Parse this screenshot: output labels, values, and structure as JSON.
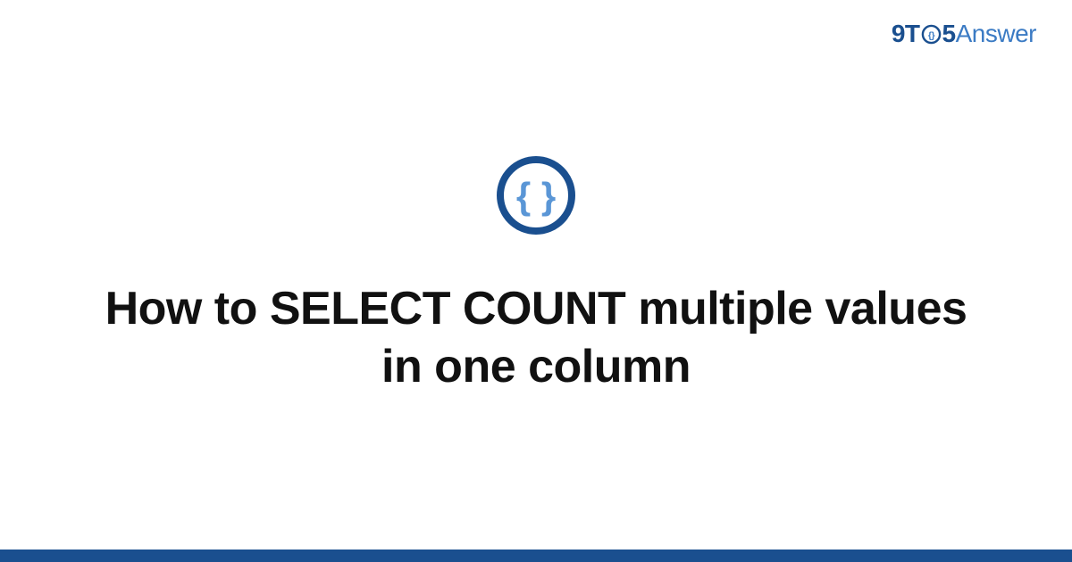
{
  "brand": {
    "part1": "9T",
    "part2": "5",
    "part3": "Answer"
  },
  "badge": {
    "icon_name": "code-braces-icon"
  },
  "title": "How to SELECT COUNT multiple values in one column",
  "colors": {
    "brand_dark": "#1a4f8f",
    "brand_light": "#3b7bc4",
    "text": "#111111",
    "background": "#ffffff"
  }
}
